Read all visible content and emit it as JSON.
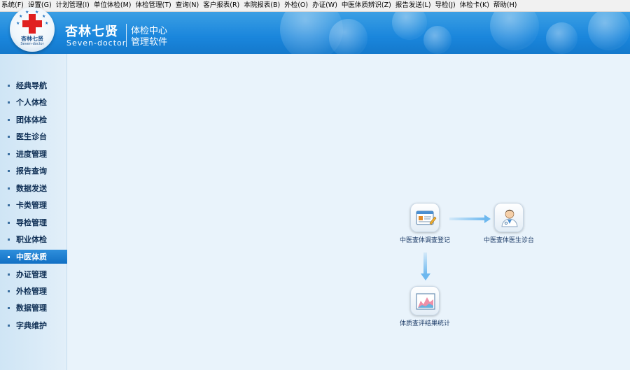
{
  "menu": [
    "系统(F)",
    "设置(G)",
    "计划管理(I)",
    "单位体检(M)",
    "体检管理(T)",
    "查询(N)",
    "客户报表(R)",
    "本院报表(B)",
    "外检(O)",
    "办证(W)",
    "中医体质辨识(Z)",
    "报告发送(L)",
    "导检(J)",
    "体检卡(K)",
    "帮助(H)"
  ],
  "header": {
    "logo_name": "杏林七贤",
    "logo_sub": "Seven-doctor",
    "brand_cn": "杏林七贤",
    "brand_en": "Seven-doctor",
    "line1": "体检中心",
    "line2": "管理软件"
  },
  "sidebar": {
    "items": [
      {
        "label": "经典导航"
      },
      {
        "label": "个人体检"
      },
      {
        "label": "团体体检"
      },
      {
        "label": "医生诊台"
      },
      {
        "label": "进度管理"
      },
      {
        "label": "报告查询"
      },
      {
        "label": "数据发送"
      },
      {
        "label": "卡类管理"
      },
      {
        "label": "导检管理"
      },
      {
        "label": "职业体检"
      },
      {
        "label": "中医体质"
      },
      {
        "label": "办证管理"
      },
      {
        "label": "外检管理"
      },
      {
        "label": "数据管理"
      },
      {
        "label": "字典维护"
      }
    ],
    "active_index": 10
  },
  "workflow": {
    "nodes": [
      {
        "label": "中医查体调查登记",
        "icon": "survey-form-icon"
      },
      {
        "label": "中医查体医生诊台",
        "icon": "doctor-icon"
      },
      {
        "label": "体质查评结果统计",
        "icon": "chart-statistics-icon"
      }
    ]
  },
  "colors": {
    "header_blue": "#1a86dc",
    "active_blue": "#1270c4",
    "background": "#e9f3fb",
    "arrow": "#6db8ef"
  }
}
